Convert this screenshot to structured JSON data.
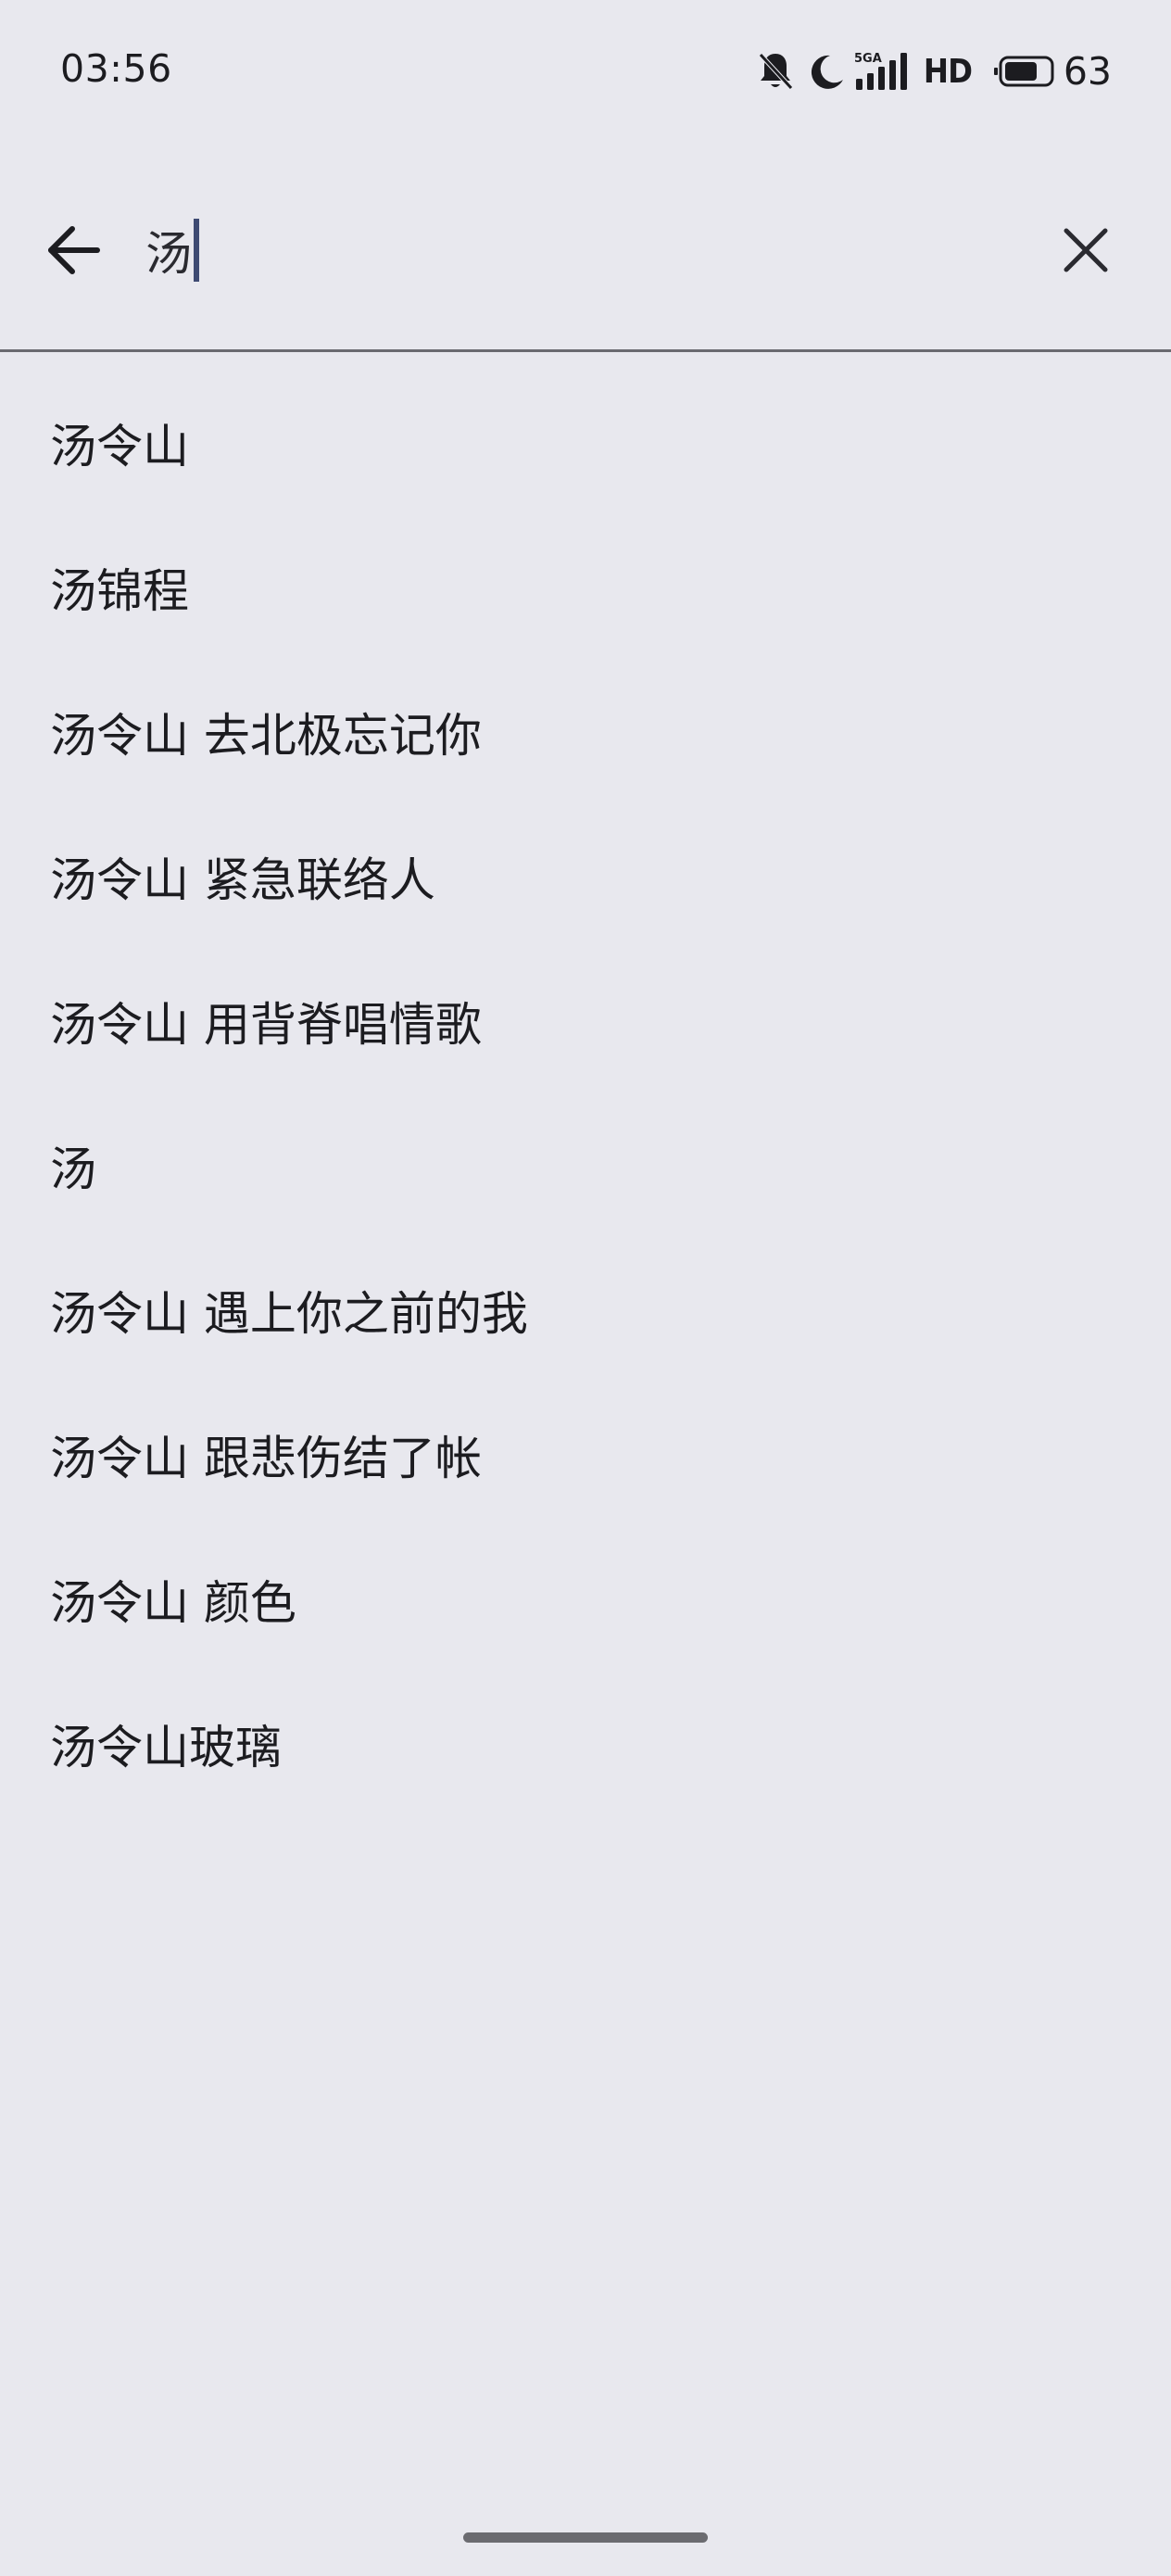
{
  "status_bar": {
    "time": "03:56",
    "network_label": "HD",
    "battery_level": "63",
    "icons": [
      "bell-muted-icon",
      "moon-icon",
      "signal-5g-icon",
      "battery-icon"
    ]
  },
  "search": {
    "query": "汤",
    "back_icon": "arrow-back-icon",
    "clear_icon": "close-icon"
  },
  "suggestions": [
    "汤令山",
    "汤锦程",
    "汤令山 去北极忘记你",
    "汤令山 紧急联络人",
    "汤令山 用背脊唱情歌",
    "汤",
    "汤令山 遇上你之前的我",
    "汤令山 跟悲伤结了帐",
    "汤令山 颜色",
    "汤令山玻璃"
  ],
  "colors": {
    "background": "#e8e8ee",
    "text": "#1c1c20",
    "caret": "#3e4a72",
    "divider": "#6a6a70"
  }
}
